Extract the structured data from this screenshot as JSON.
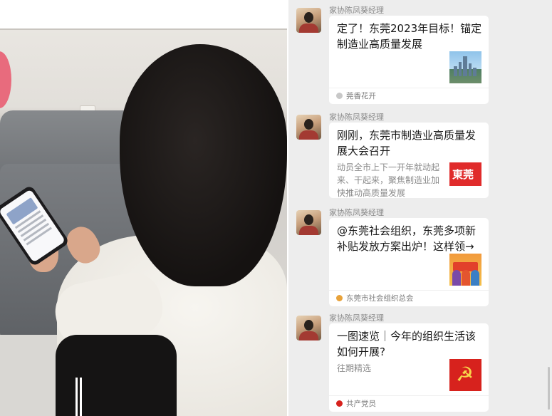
{
  "chat": {
    "messages": [
      {
        "sender": "家协陈凤葵经理",
        "title": "定了！东莞2023年目标！锚定制造业高质量发展",
        "description": "",
        "source": "莞香花开",
        "source_icon_color": "#c8c8c8",
        "thumbnail": "city-skyline-image"
      },
      {
        "sender": "家协陈凤葵经理",
        "title": "刚刚，东莞市制造业高质量发展大会召开",
        "description": "动员全市上下一开年就动起来、干起来，聚焦制造业加快推动高质量发展",
        "source": "",
        "thumbnail": "dongguan-logo-image",
        "thumbnail_text": "東莞"
      },
      {
        "sender": "家协陈凤葵经理",
        "title": "@东莞社会组织，东莞多项新补贴发放方案出炉！这样领→",
        "description": "",
        "source": "东莞市社会组织总会",
        "source_icon_color": "#e8a23a",
        "thumbnail": "subsidy-poster-image"
      },
      {
        "sender": "家协陈凤葵经理",
        "title": "一图速览｜今年的组织生活该如何开展?",
        "description": "往期精选",
        "source": "共产党员",
        "source_icon_color": "#d7221d",
        "thumbnail": "party-emblem-image"
      }
    ]
  },
  "colors": {
    "chat_background": "#ededed",
    "card_background": "#ffffff",
    "accent_red": "#d7221d"
  }
}
